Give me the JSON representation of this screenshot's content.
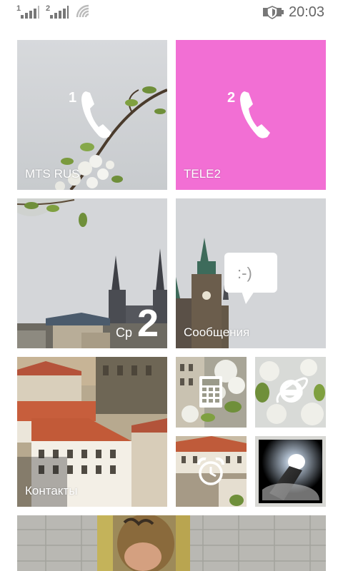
{
  "status_bar": {
    "sim1_label": "1",
    "sim2_label": "2",
    "time": "20:03",
    "icons": [
      "signal-icon",
      "signal-icon",
      "wifi-icon",
      "battery-saver-icon"
    ]
  },
  "tiles": {
    "phone1": {
      "sim": "1",
      "label": "MTS RUS",
      "icon": "phone-icon"
    },
    "phone2": {
      "sim": "2",
      "label": "TELE2",
      "icon": "phone-icon",
      "color": "#f26fd4"
    },
    "calendar": {
      "weekday": "Ср",
      "day": "2"
    },
    "messages": {
      "label": "Сообщения",
      "icon": "message-smiley-icon",
      "emoticon": ":-)"
    },
    "contacts": {
      "label": "Контакты"
    },
    "calculator": {
      "icon": "calculator-icon"
    },
    "browser": {
      "icon": "internet-explorer-icon"
    },
    "alarms": {
      "icon": "alarm-clock-icon"
    },
    "flashlight": {
      "icon": "flashlight-icon"
    },
    "photos": {
      "icon": "photo-icon"
    }
  }
}
